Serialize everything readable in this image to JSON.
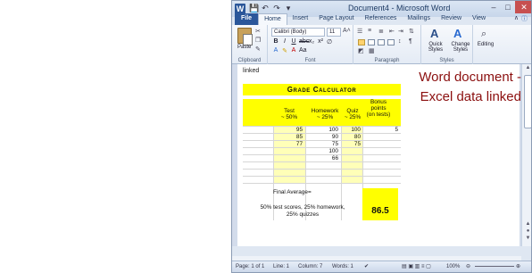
{
  "window": {
    "title": "Document4 - Microsoft Word",
    "app_icon": "W"
  },
  "quick_access": [
    "save-icon",
    "undo-icon",
    "redo-icon",
    "customize-icon"
  ],
  "tabs": [
    {
      "label": "File"
    },
    {
      "label": "Home"
    },
    {
      "label": "Insert"
    },
    {
      "label": "Page Layout"
    },
    {
      "label": "References"
    },
    {
      "label": "Mailings"
    },
    {
      "label": "Review"
    },
    {
      "label": "View"
    }
  ],
  "ribbon": {
    "clipboard": {
      "paste_label": "Paste",
      "group_label": "Clipboard"
    },
    "font": {
      "font_name": "Calibri (Body)",
      "font_size": "11",
      "group_label": "Font"
    },
    "paragraph": {
      "group_label": "Paragraph"
    },
    "styles": {
      "quick_styles_label": "Quick Styles",
      "change_styles_label": "Change Styles",
      "group_label": "Styles"
    },
    "editing": {
      "label": "Editing"
    }
  },
  "document": {
    "linked_text": "linked",
    "annotation_line1": "Word document -",
    "annotation_line2": "Excel data linked"
  },
  "sheet": {
    "title": "Grade Calculator",
    "headers": {
      "test": "Test\n~ 50%",
      "homework": "Homework\n~ 25%",
      "quiz": "Quiz\n~ 25%",
      "bonus": "Bonus\npoints\n(on tests)"
    },
    "test_values": [
      "95",
      "85",
      "77"
    ],
    "homework_values": [
      "100",
      "90",
      "75",
      "100",
      "66"
    ],
    "quiz_values": [
      "100",
      "80",
      "75"
    ],
    "bonus_values": [
      "5"
    ],
    "final_label": "Final Average=",
    "note": "50% test scores, 25% homework,\n25% quizzes",
    "result": "86.5"
  },
  "status": {
    "page": "Page: 1 of 1",
    "line": "Line: 1",
    "column": "Column: 7",
    "words": "Words: 1",
    "zoom": "100%"
  }
}
